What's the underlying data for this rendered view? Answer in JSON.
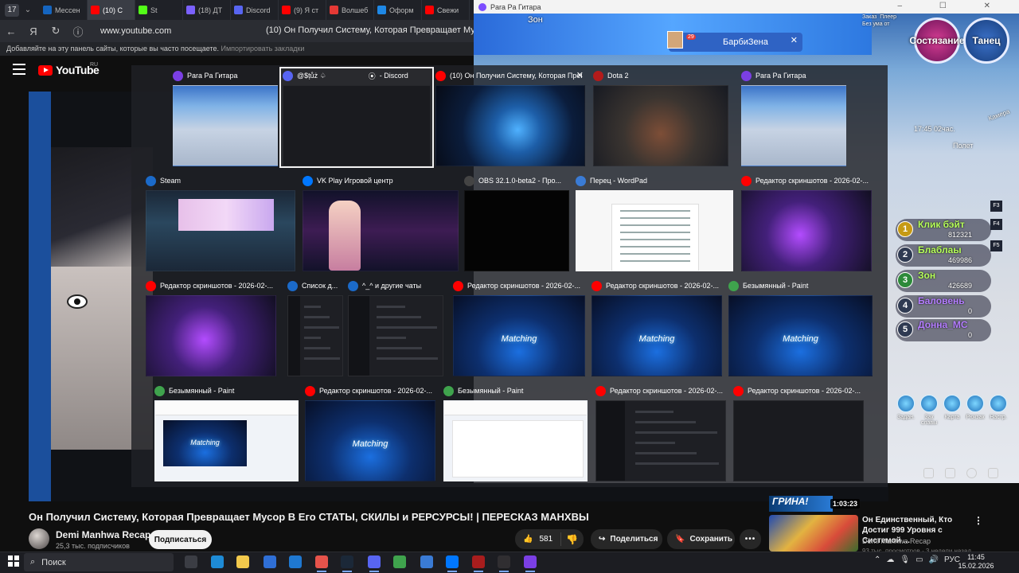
{
  "browser": {
    "tab_count": "17",
    "tabs": [
      {
        "label": "Мессен",
        "color": "#1565c0"
      },
      {
        "label": "(10) С",
        "color": "#ff0000"
      },
      {
        "label": "St",
        "color": "#53fc18"
      },
      {
        "label": "(18) ДТ",
        "color": "#7b61ff"
      },
      {
        "label": "Discord",
        "color": "#5865f2"
      },
      {
        "label": "(9) Я ст",
        "color": "#ff0000"
      },
      {
        "label": "Волшеб",
        "color": "#e53935"
      },
      {
        "label": "Оформ",
        "color": "#1e88e5"
      },
      {
        "label": "Свежи",
        "color": "#ff0000"
      }
    ],
    "url": "www.youtube.com",
    "page_title": "(10) Он Получил Систему, Которая Превращает Мусор В",
    "bookmarks_hint": "Добавляйте на эту панель сайты, которые вы часто посещаете.",
    "bookmarks_import": "Импортировать закладки"
  },
  "youtube": {
    "logo": "YouTube",
    "country": "RU"
  },
  "game": {
    "window_title": "Рara Рa Гитара",
    "player_name": "Зон",
    "target_name": "БарбиЗена",
    "target_level": "29",
    "profile_text": "Заказ  Плеер\nБез ума от",
    "buttons": {
      "left": "Состязание",
      "right": "Танец"
    },
    "time": "17:45  02час.",
    "camera": "Камера",
    "flight": "Полет",
    "ranking": [
      {
        "rank": "1",
        "name": "Клик бэйт",
        "score": "812321"
      },
      {
        "rank": "2",
        "name": "Блаблаы",
        "score": "469986"
      },
      {
        "rank": "3",
        "name": "Зон",
        "score": "426689"
      },
      {
        "rank": "4",
        "name": "Баловень",
        "score": "0"
      },
      {
        "rank": "5",
        "name": "Донна_МС",
        "score": "0"
      }
    ],
    "fkeys": [
      "F3",
      "F4",
      "F5"
    ],
    "menu": [
      "Задан.",
      "Зак славы",
      "Карта",
      "Рюкзак",
      "Настр."
    ]
  },
  "switcher": {
    "windows": [
      {
        "title": "Рara Рa Гитара",
        "icon": "#7b3fe4",
        "thumb": "game"
      },
      {
        "title": "@$țůż ♤",
        "title2": "- Discord",
        "icon": "#5865f2",
        "thumb": "dark",
        "selected": true
      },
      {
        "title": "(10) Он Получил Систему, Которая Прев...",
        "icon": "#ff0000",
        "thumb": "space",
        "close": "✕"
      },
      {
        "title": "Dota 2",
        "icon": "#b31b1b",
        "thumb": "dota"
      },
      {
        "title": "Рara Рa Гитара",
        "icon": "#7b3fe4",
        "thumb": "game"
      },
      {
        "title": "Steam",
        "icon": "#1b6ac9",
        "thumb": "steam"
      },
      {
        "title": "VK Play Игровой центр",
        "icon": "#0077ff",
        "thumb": "vk"
      },
      {
        "title": "OBS 32.1.0-beta2 - Про...",
        "icon": "#444444",
        "thumb": "black"
      },
      {
        "title": "Перец - WordPad",
        "icon": "#3a7bd5",
        "thumb": "white"
      },
      {
        "title": "Редактор скриншотов - 2026-02-...",
        "icon": "#ff0000",
        "thumb": "purple"
      },
      {
        "title": "Редактор скриншотов - 2026-02-...",
        "icon": "#ff0000",
        "thumb": "purple"
      },
      {
        "title": "Список д...",
        "icon": "#1b6ac9",
        "thumb": "chat"
      },
      {
        "title": "^_^ и другие чаты",
        "icon": "#1b6ac9",
        "thumb": "chat"
      },
      {
        "title": "Редактор скриншотов - 2026-02-...",
        "icon": "#ff0000",
        "thumb": "match"
      },
      {
        "title": "Редактор скриншотов - 2026-02-...",
        "icon": "#ff0000",
        "thumb": "match"
      },
      {
        "title": "Безымянный - Paint",
        "icon": "#3fa34d",
        "thumb": "match"
      },
      {
        "title": "Безымянный - Paint",
        "icon": "#3fa34d",
        "thumb": "paint"
      },
      {
        "title": "Редактор скриншотов - 2026-02-...",
        "icon": "#ff0000",
        "thumb": "match"
      },
      {
        "title": "Безымянный - Paint",
        "icon": "#3fa34d",
        "thumb": "paint-white"
      },
      {
        "title": "Редактор скриншотов - 2026-02-...",
        "icon": "#ff0000",
        "thumb": "chat"
      },
      {
        "title": "Редактор скриншотов - 2026-02-...",
        "icon": "#ff0000",
        "thumb": "dark"
      }
    ],
    "matching_label": "Matching"
  },
  "video": {
    "title": "Он Получил Систему, Которая Превращает Мусор В Его СТАТЫ, СКИЛЫ и РЕРСУРСЫ! | ПЕРЕСКАЗ МАНХВЫ",
    "channel": "Demi Manhwa Recap",
    "subscribers": "25,3 тыс. подписчиков",
    "subscribe_label": "Подписаться",
    "likes": "581",
    "share_label": "Поделиться",
    "save_label": "Сохранить",
    "more_label": "•••"
  },
  "recommendation": {
    "banner": "ГРИНА!",
    "duration": "1:03:23",
    "title": "Он Единственный, Кто Достиг 999 Уровня с Системой ...",
    "channel": "Demi Manhwa Recap",
    "meta": "93 тыс. просмотров · 3 недели назад"
  },
  "taskbar": {
    "search_placeholder": "Поиск",
    "lang": "РУС",
    "time": "11:45",
    "date": "15.02.2026",
    "apps": [
      {
        "name": "task-view-icon",
        "color": "#3b3d44"
      },
      {
        "name": "edge-icon",
        "color": "#1e8bd6"
      },
      {
        "name": "file-explorer-icon",
        "color": "#f2c94c"
      },
      {
        "name": "store-icon",
        "color": "#2f6fd6"
      },
      {
        "name": "mail-icon",
        "color": "#1f78d1"
      },
      {
        "name": "yandex-browser-icon",
        "color": "#e6534b"
      },
      {
        "name": "steam-icon",
        "color": "#1b2838"
      },
      {
        "name": "discord-icon",
        "color": "#5865f2"
      },
      {
        "name": "paint-icon",
        "color": "#3fa34d"
      },
      {
        "name": "wordpad-icon",
        "color": "#3a7bd5"
      },
      {
        "name": "vk-play-icon",
        "color": "#0077ff"
      },
      {
        "name": "dota-icon",
        "color": "#a81d1d"
      },
      {
        "name": "obs-icon",
        "color": "#302e31"
      },
      {
        "name": "game-icon",
        "color": "#7b3fe4"
      }
    ]
  }
}
